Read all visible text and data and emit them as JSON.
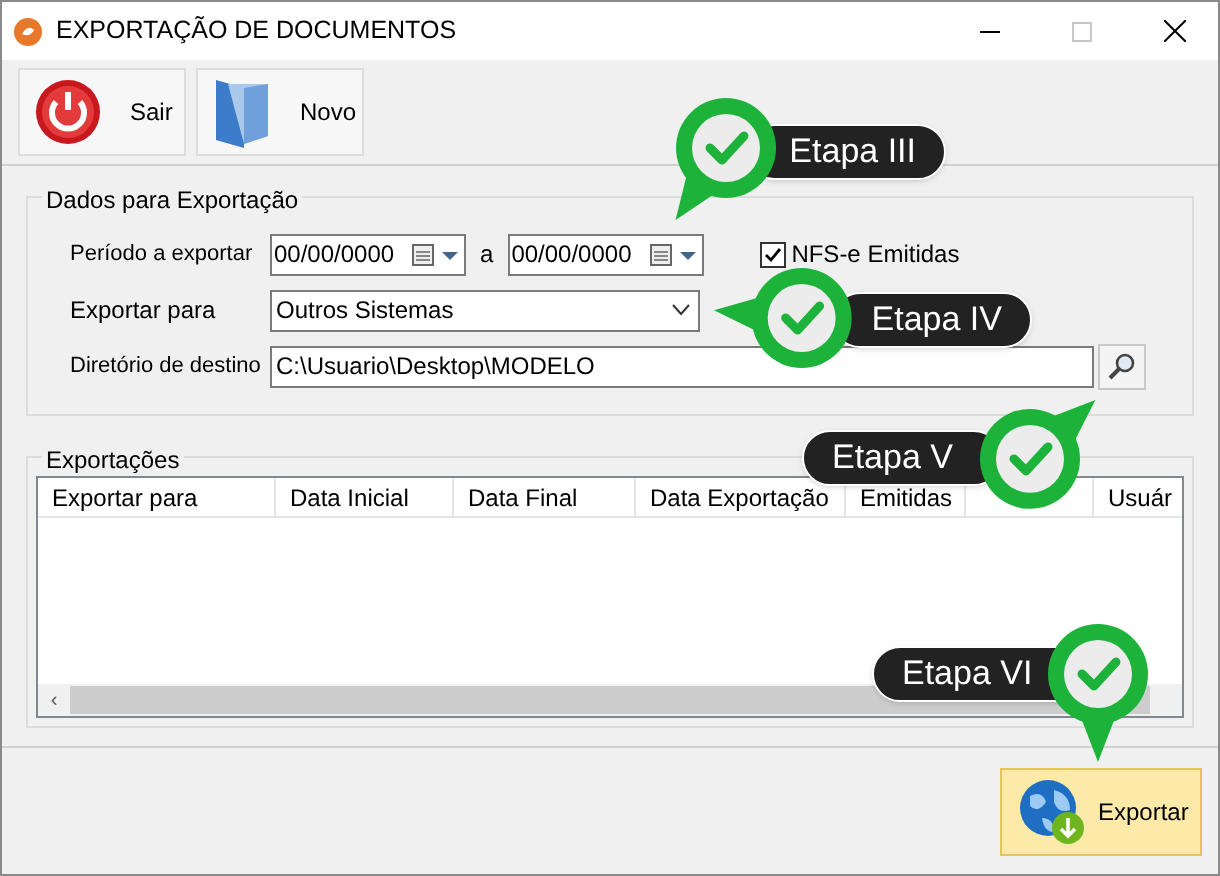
{
  "window": {
    "title": "EXPORTAÇÃO DE DOCUMENTOS"
  },
  "toolbar": [
    {
      "kind": "exit",
      "label": "Sair"
    },
    {
      "kind": "new",
      "label": "Novo"
    }
  ],
  "export_data": {
    "title": "Dados para Exportação",
    "period": {
      "label": "Período a exportar",
      "from": "00/00/0000",
      "separator": "a",
      "to": "00/00/0000"
    },
    "nfse_checkbox": {
      "label": "NFS-e Emitidas",
      "checked": true
    },
    "export_to": {
      "label": "Exportar para",
      "value": "Outros Sistemas"
    },
    "directory": {
      "label": "Diretório de destino",
      "value": "C:\\Usuario\\Desktop\\MODELO"
    }
  },
  "exports": {
    "title": "Exportações",
    "columns": [
      {
        "kind": "text",
        "label": "Exportar para"
      },
      {
        "kind": "text",
        "label": "Data Inicial"
      },
      {
        "kind": "text",
        "label": "Data Final"
      },
      {
        "kind": "text",
        "label": "Data Exportação"
      },
      {
        "kind": "text",
        "label": "Emitidas"
      },
      {
        "kind": "covered"
      },
      {
        "kind": "text",
        "label": "Usuár"
      }
    ],
    "scroll_left": "‹"
  },
  "footer": {
    "button": "Exportar"
  },
  "callouts": [
    {
      "label": "Etapa III"
    },
    {
      "label": "Etapa IV"
    },
    {
      "label": "Etapa V"
    },
    {
      "label": "Etapa VI"
    }
  ]
}
